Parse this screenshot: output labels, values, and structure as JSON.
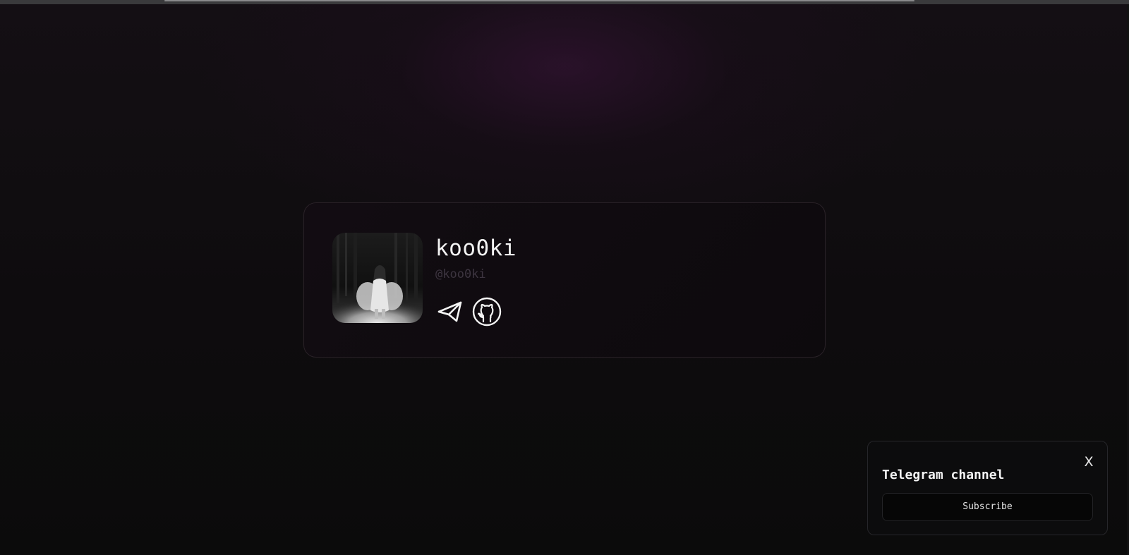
{
  "profile": {
    "name": "koo0ki",
    "handle": "@koo0ki",
    "avatar_alt": "",
    "socials": [
      {
        "icon": "telegram-icon"
      },
      {
        "icon": "github-icon"
      }
    ]
  },
  "toast": {
    "title": "Telegram channel",
    "close_label": "X",
    "button_label": "Subscribe"
  },
  "colors": {
    "background": "#0b0b0c",
    "accent_glow": "#3c143c",
    "text_primary": "#f2f2f2",
    "text_muted": "#3d3540",
    "card_border": "#2a2228"
  }
}
